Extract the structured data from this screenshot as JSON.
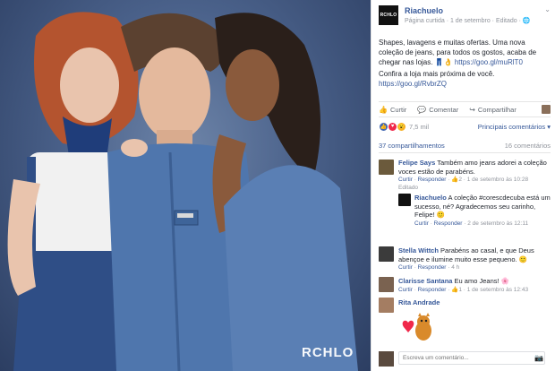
{
  "photo": {
    "watermark": "RCHLO"
  },
  "header": {
    "logo_text": "RCHLO",
    "page_name": "Riachuelo",
    "meta": "Página curtida · 1 de setembro · Editado ·",
    "menu_icon": "chevron-down-icon"
  },
  "post": {
    "text": "Shapes, lavagens e muitas ofertas. Uma nova coleção de jeans, para todos os gostos, acaba de chegar nas lojas. 👖👌",
    "link1": "https://goo.gl/muRlT0",
    "text2": "Confira a loja mais próxima de você.",
    "link2": "https://goo.gl/RvbrZQ"
  },
  "actions": {
    "like": "Curtir",
    "comment": "Comentar",
    "share": "Compartilhar"
  },
  "reactions": {
    "count": "7,5 mil",
    "relevance": "Principais comentários ▾"
  },
  "stats": {
    "shares": "37 compartilhamentos",
    "comments": "16 comentários"
  },
  "comments": [
    {
      "name": "Felipe Says",
      "text": "Também amo jeans adorei a coleção voces estão de parabéns.",
      "like": "Curtir",
      "reply": "Responder",
      "likes": "2",
      "time": "1 de setembro às 10:28",
      "edited": "Editado"
    },
    {
      "name": "Riachuelo",
      "text": "A coleção #corescdecuba está um sucesso, né? Agradecemos seu carinho, Felipe! 🙂",
      "like": "Curtir",
      "reply": "Responder",
      "time": "2 de setembro às 12:11"
    },
    {
      "name": "Stella Wittch",
      "text": "Parabéns ao casal, e que Deus abençoe e ilumine muito esse pequeno. 🙂",
      "like": "Curtir",
      "reply": "Responder",
      "time": "4 h"
    },
    {
      "name": "Clarisse Santana",
      "text": "Eu amo Jeans! 🌸",
      "like": "Curtir",
      "reply": "Responder",
      "likes": "1",
      "time": "1 de setembro às 12:43"
    },
    {
      "name": "Rita Andrade",
      "text": ""
    }
  ],
  "composer": {
    "placeholder": "Escreva um comentário..."
  },
  "colors": {
    "link": "#365899",
    "meta": "#90949c",
    "like_blue": "#4267b2",
    "love_red": "#f0284a"
  }
}
